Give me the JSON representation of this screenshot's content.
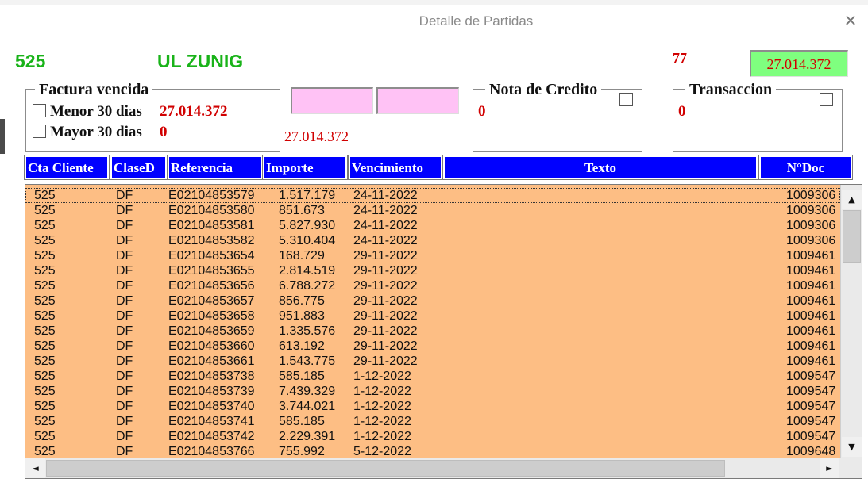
{
  "window": {
    "title": "Detalle de Partidas",
    "close_glyph": "✕"
  },
  "header": {
    "cliente_num": "525",
    "cliente_nombre": "UL ZUNIG",
    "count": "77",
    "total": "27.014.372"
  },
  "factura_vencida": {
    "legend": "Factura vencida",
    "menor_label": "Menor 30 dias",
    "menor_value": "27.014.372",
    "mayor_label": "Mayor 30 dias",
    "mayor_value": "0"
  },
  "mid_total": "27.014.372",
  "nota_credito": {
    "legend": "Nota de Credito",
    "value": "0"
  },
  "transaccion": {
    "legend": "Transaccion",
    "value": "0"
  },
  "table": {
    "columns": [
      "Cta Cliente",
      "ClaseD",
      "Referencia",
      "Importe",
      "Vencimiento",
      "Texto",
      "N°Doc"
    ],
    "rows": [
      [
        "525",
        "DF",
        "E02104853579",
        "1.517.179",
        "24-11-2022",
        "",
        "1009306"
      ],
      [
        "525",
        "DF",
        "E02104853580",
        "851.673",
        "24-11-2022",
        "",
        "1009306"
      ],
      [
        "525",
        "DF",
        "E02104853581",
        "5.827.930",
        "24-11-2022",
        "",
        "1009306"
      ],
      [
        "525",
        "DF",
        "E02104853582",
        "5.310.404",
        "24-11-2022",
        "",
        "1009306"
      ],
      [
        "525",
        "DF",
        "E02104853654",
        "168.729",
        "29-11-2022",
        "",
        "1009461"
      ],
      [
        "525",
        "DF",
        "E02104853655",
        "2.814.519",
        "29-11-2022",
        "",
        "1009461"
      ],
      [
        "525",
        "DF",
        "E02104853656",
        "6.788.272",
        "29-11-2022",
        "",
        "1009461"
      ],
      [
        "525",
        "DF",
        "E02104853657",
        "856.775",
        "29-11-2022",
        "",
        "1009461"
      ],
      [
        "525",
        "DF",
        "E02104853658",
        "951.883",
        "29-11-2022",
        "",
        "1009461"
      ],
      [
        "525",
        "DF",
        "E02104853659",
        "1.335.576",
        "29-11-2022",
        "",
        "1009461"
      ],
      [
        "525",
        "DF",
        "E02104853660",
        "613.192",
        "29-11-2022",
        "",
        "1009461"
      ],
      [
        "525",
        "DF",
        "E02104853661",
        "1.543.775",
        "29-11-2022",
        "",
        "1009461"
      ],
      [
        "525",
        "DF",
        "E02104853738",
        "585.185",
        "1-12-2022",
        "",
        "1009547"
      ],
      [
        "525",
        "DF",
        "E02104853739",
        "7.439.329",
        "1-12-2022",
        "",
        "1009547"
      ],
      [
        "525",
        "DF",
        "E02104853740",
        "3.744.021",
        "1-12-2022",
        "",
        "1009547"
      ],
      [
        "525",
        "DF",
        "E02104853741",
        "585.185",
        "1-12-2022",
        "",
        "1009547"
      ],
      [
        "525",
        "DF",
        "E02104853742",
        "2.229.391",
        "1-12-2022",
        "",
        "1009547"
      ],
      [
        "525",
        "DF",
        "E02104853766",
        "755.992",
        "5-12-2022",
        "",
        "1009648"
      ]
    ]
  },
  "scroll": {
    "up": "▲",
    "down": "▼",
    "left": "◄",
    "right": "►"
  },
  "colors": {
    "header_blue": "#0000ff",
    "row_bg": "#fdbe84",
    "accent_green": "#19b319",
    "total_box": "#7fff7f",
    "pink_field": "#ffc2f5",
    "value_red": "#d10000"
  }
}
